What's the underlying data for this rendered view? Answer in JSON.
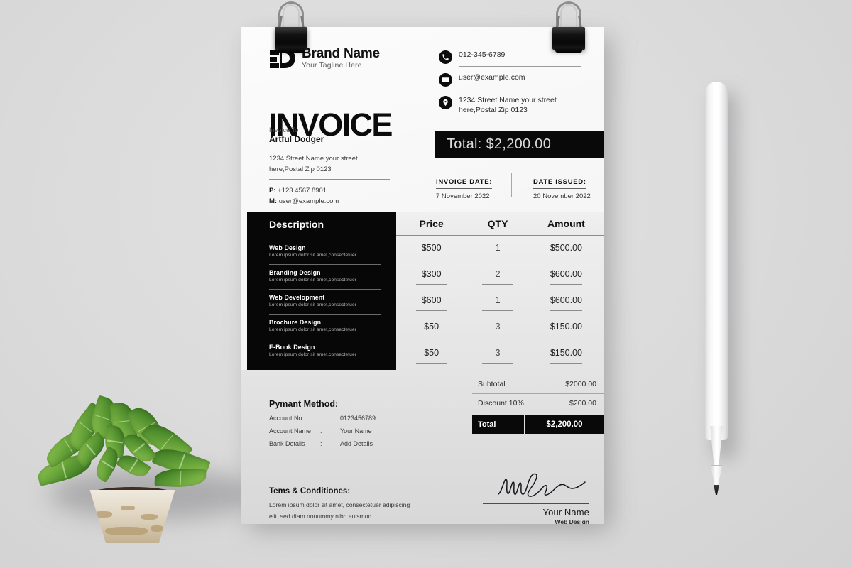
{
  "document": {
    "type": "invoice-mockup",
    "paper_title": "INVOICE"
  },
  "brand": {
    "name": "Brand Name",
    "tagline": "Your Tagline Here",
    "logo_icon": "brand-d-mark-icon"
  },
  "contacts": [
    {
      "icon": "phone-icon",
      "text": "012-345-6789"
    },
    {
      "icon": "envelope-icon",
      "text": "user@example.com"
    },
    {
      "icon": "location-pin-icon",
      "text": "1234 Street Name your street here,Postal Zip 0123"
    }
  ],
  "invoice_to": {
    "label": "Invoice To",
    "name": "Artful Dodger",
    "address_line1": "1234 Street Name your street",
    "address_line2": "here,Postal Zip 0123",
    "phone_prefix": "P:",
    "phone": "+123 4567 8901",
    "mail_prefix": "M:",
    "mail": "user@example.com"
  },
  "total_banner": {
    "text": "Total: $2,200.00"
  },
  "dates": {
    "invoice_date_label": "INVOICE DATE:",
    "invoice_date_value": "7 November 2022",
    "date_issued_label": "DATE ISSUED:",
    "date_issued_value": "20 November 2022"
  },
  "table": {
    "headers": {
      "description": "Description",
      "price": "Price",
      "qty": "QTY",
      "amount": "Amount"
    },
    "rows": [
      {
        "title": "Web Design",
        "sub": "Lorem ipsum dolor sit amet,consectetuer",
        "price": "$500",
        "qty": "1",
        "amount": "$500.00"
      },
      {
        "title": "Branding Design",
        "sub": "Lorem ipsum dolor sit amet,consectetuer",
        "price": "$300",
        "qty": "2",
        "amount": "$600.00"
      },
      {
        "title": "Web Development",
        "sub": "Lorem ipsum dolor sit amet,consectetuer",
        "price": "$600",
        "qty": "1",
        "amount": "$600.00"
      },
      {
        "title": "Brochure Design",
        "sub": "Lorem ipsum dolor sit amet,consectetuer",
        "price": "$50",
        "qty": "3",
        "amount": "$150.00"
      },
      {
        "title": "E-Book Design",
        "sub": "Lorem ipsum dolor sit amet,consectetuer",
        "price": "$50",
        "qty": "3",
        "amount": "$150.00"
      }
    ]
  },
  "summary": {
    "subtotal_label": "Subtotal",
    "subtotal_value": "$2000.00",
    "discount_label": "Discount 10%",
    "discount_value": "$200.00",
    "total_label": "Total",
    "total_value": "$2,200.00"
  },
  "payment": {
    "title": "Pymant Method:",
    "rows": [
      {
        "key": "Account No",
        "sep": ":",
        "value": "0123456789"
      },
      {
        "key": "Account Name",
        "sep": ":",
        "value": "Your Name"
      },
      {
        "key": "Bank Details",
        "sep": ":",
        "value": "Add Details"
      }
    ]
  },
  "terms": {
    "title": "Tems & Conditiones:",
    "line1": "Lorem ipsum dolor sit amet, consectetuer adipiscing",
    "line2": "elit, sed diam nonummy nibh euismod"
  },
  "signature": {
    "icon": "handwritten-signature-icon",
    "name": "Your Name",
    "role": "Web Design"
  },
  "props": {
    "clip_left": "binder-clip-icon",
    "clip_right": "binder-clip-icon",
    "pen": "white-stylus-pen",
    "plant": "potted-succulent-plant"
  },
  "colors": {
    "ink_black": "#090909",
    "paper_light": "#f7f7f7",
    "paper_gray": "#dedede",
    "scene_bg": "#dcdcdc",
    "muted_text": "#3b3b3b"
  }
}
